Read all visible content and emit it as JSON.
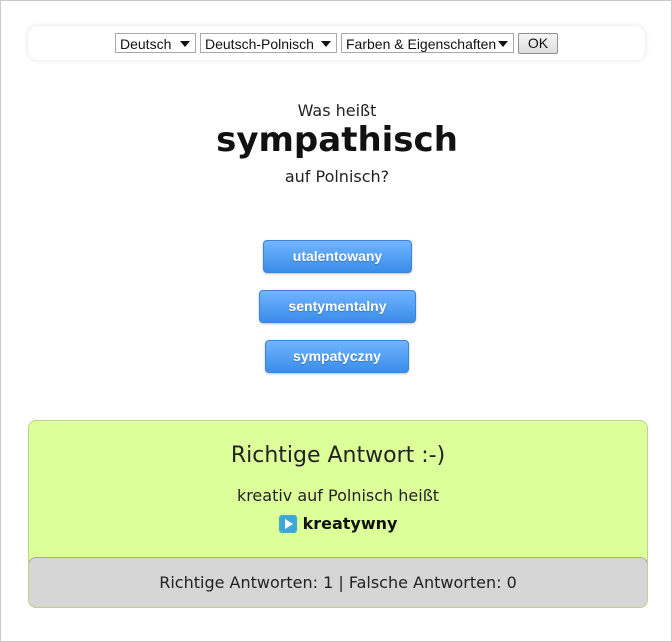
{
  "toolbar": {
    "language_select": "Deutsch",
    "pair_select": "Deutsch-Polnisch",
    "category_select": "Farben & Eigenschaften",
    "ok_label": "OK"
  },
  "question": {
    "prefix": "Was heißt",
    "word": "sympathisch",
    "suffix": "auf Polnisch?"
  },
  "answers": [
    {
      "label": "utalentowany"
    },
    {
      "label": "sentymentalny"
    },
    {
      "label": "sympatyczny"
    }
  ],
  "result": {
    "title": "Richtige Antwort :-)",
    "line": "kreativ auf Polnisch heißt",
    "answer": "kreatywny",
    "icon": "play-icon"
  },
  "stats": {
    "text": "Richtige Antworten: 1 | Falsche Antworten: 0"
  },
  "colors": {
    "button_blue": "#3a8de9",
    "result_green": "#dcff99",
    "stats_gray": "#d6d6d6"
  }
}
